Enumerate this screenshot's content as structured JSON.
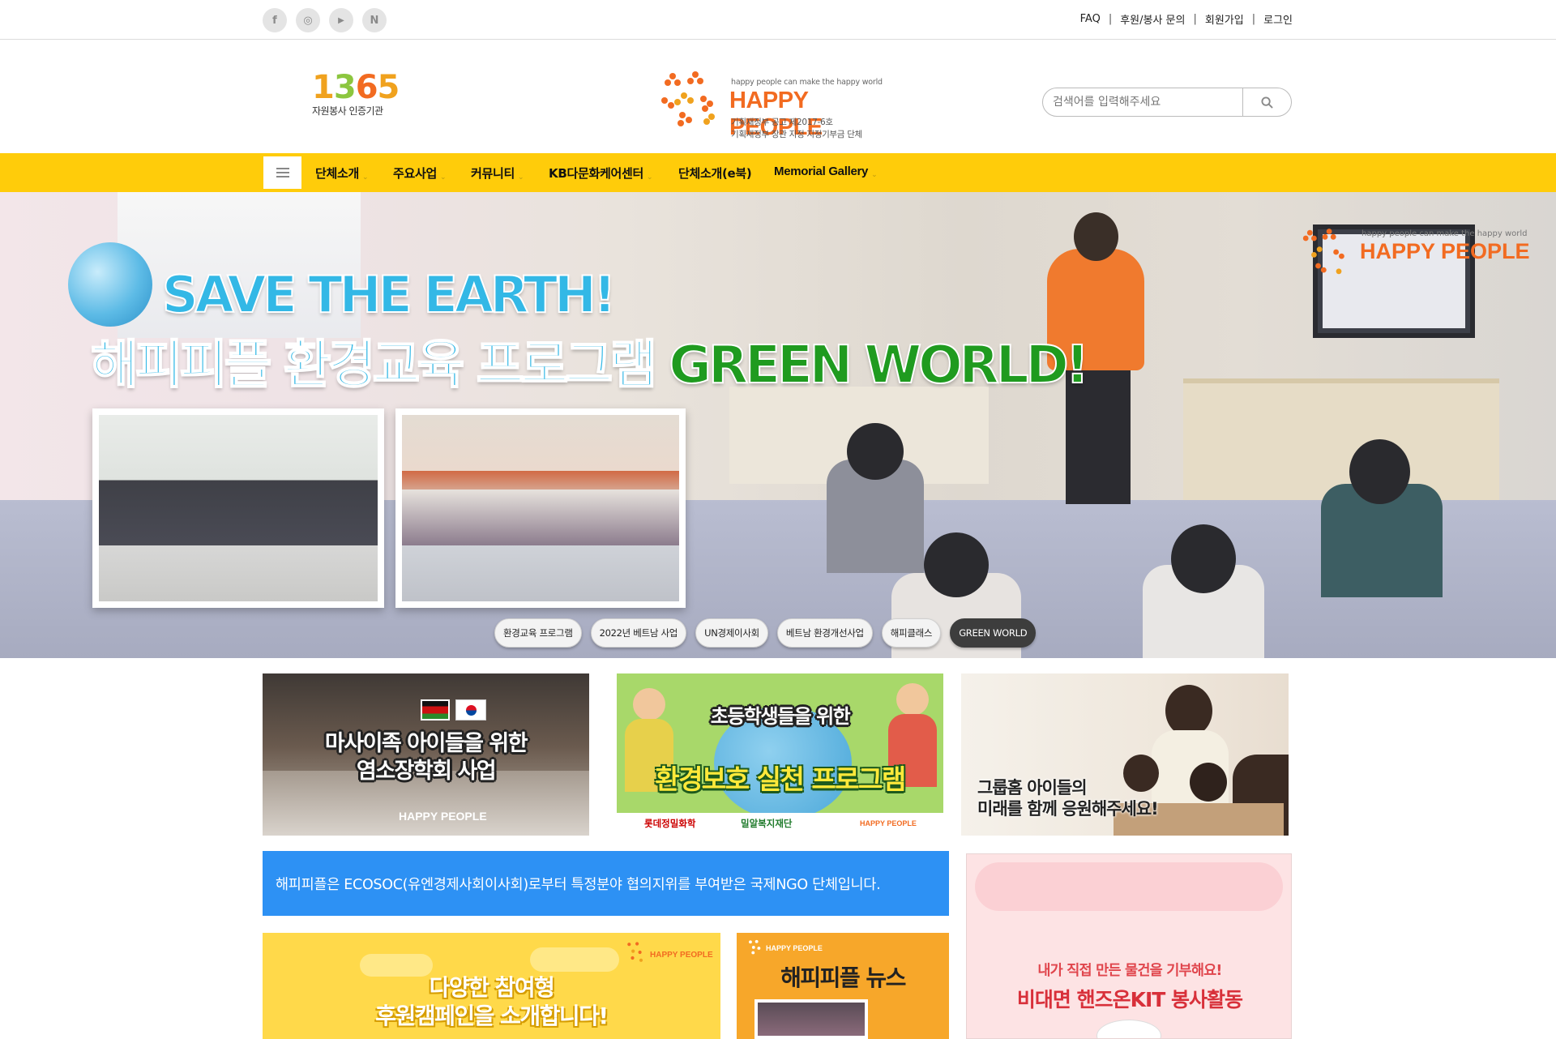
{
  "topbar": {
    "social": [
      {
        "icon": "facebook-icon",
        "glyph": "f"
      },
      {
        "icon": "instagram-icon",
        "glyph": "◎"
      },
      {
        "icon": "youtube-icon",
        "glyph": "▶"
      },
      {
        "icon": "naver-icon",
        "glyph": "N"
      }
    ],
    "links": [
      "FAQ",
      "후원/봉사 문의",
      "회원가입",
      "로그인"
    ],
    "separator": "|"
  },
  "header": {
    "logo1365": {
      "digits": "1365",
      "caption": "자원봉사 인증기관"
    },
    "brand": {
      "tagline": "happy people can make the happy world",
      "name": "HAPPY PEOPLE",
      "line1": "기획재정부 공고 제2017-6호",
      "line2": "기획재정부 장관 지정 지정기부금 단체",
      "accent": "#f26b21"
    },
    "search": {
      "placeholder": "검색어를 입력해주세요",
      "icon": "search-icon"
    }
  },
  "nav": {
    "menu_icon": "hamburger-icon",
    "items": [
      "단체소개",
      "주요사업",
      "커뮤니티",
      "KB다문화케어센터",
      "단체소개(e북)",
      "Memorial Gallery"
    ],
    "background": "#ffcc0a"
  },
  "hero": {
    "title_line1": "SAVE THE EARTH!",
    "title_line2_ko": "해피피플 환경교육 프로그램",
    "title_line2_en": "GREEN WORLD!",
    "logo_tagline": "happy people can make the happy world",
    "logo_name": "HAPPY PEOPLE",
    "tabs": [
      "환경교육 프로그램",
      "2022년 베트남 사업",
      "UN경제이사회",
      "베트남 환경개선사업",
      "해피클래스",
      "GREEN WORLD"
    ],
    "active_tab": "GREEN WORLD"
  },
  "banners": {
    "masai": {
      "line1": "마사이족 아이들을 위한",
      "line2": "염소장학회 사업",
      "logo": "HAPPY PEOPLE"
    },
    "eco": {
      "line1": "초등학생들을 위한",
      "line2": "환경보호 실천 프로그램",
      "sponsor1": "롯데정밀화학",
      "sponsor2": "밀알복지재단",
      "logo": "HAPPY PEOPLE"
    },
    "grouphome": {
      "line1": "그룹홈 아이들의",
      "line2": "미래를 함께 응원해주세요!"
    },
    "ecosoc": "해피피플은 ECOSOC(유엔경제사회이사회)로부터 특정분야 협의지위를 부여받은 국제NGO 단체입니다.",
    "campaign": {
      "line1": "다양한 참여형",
      "line2": "후원캠페인을 소개합니다!",
      "logo": "HAPPY PEOPLE"
    },
    "news": {
      "title": "해피피플 뉴스",
      "logo": "HAPPY PEOPLE"
    },
    "handson": {
      "line1": "내가 직접 만든 물건을 기부해요!",
      "line2": "비대면 핸즈온KIT 봉사활동"
    }
  }
}
